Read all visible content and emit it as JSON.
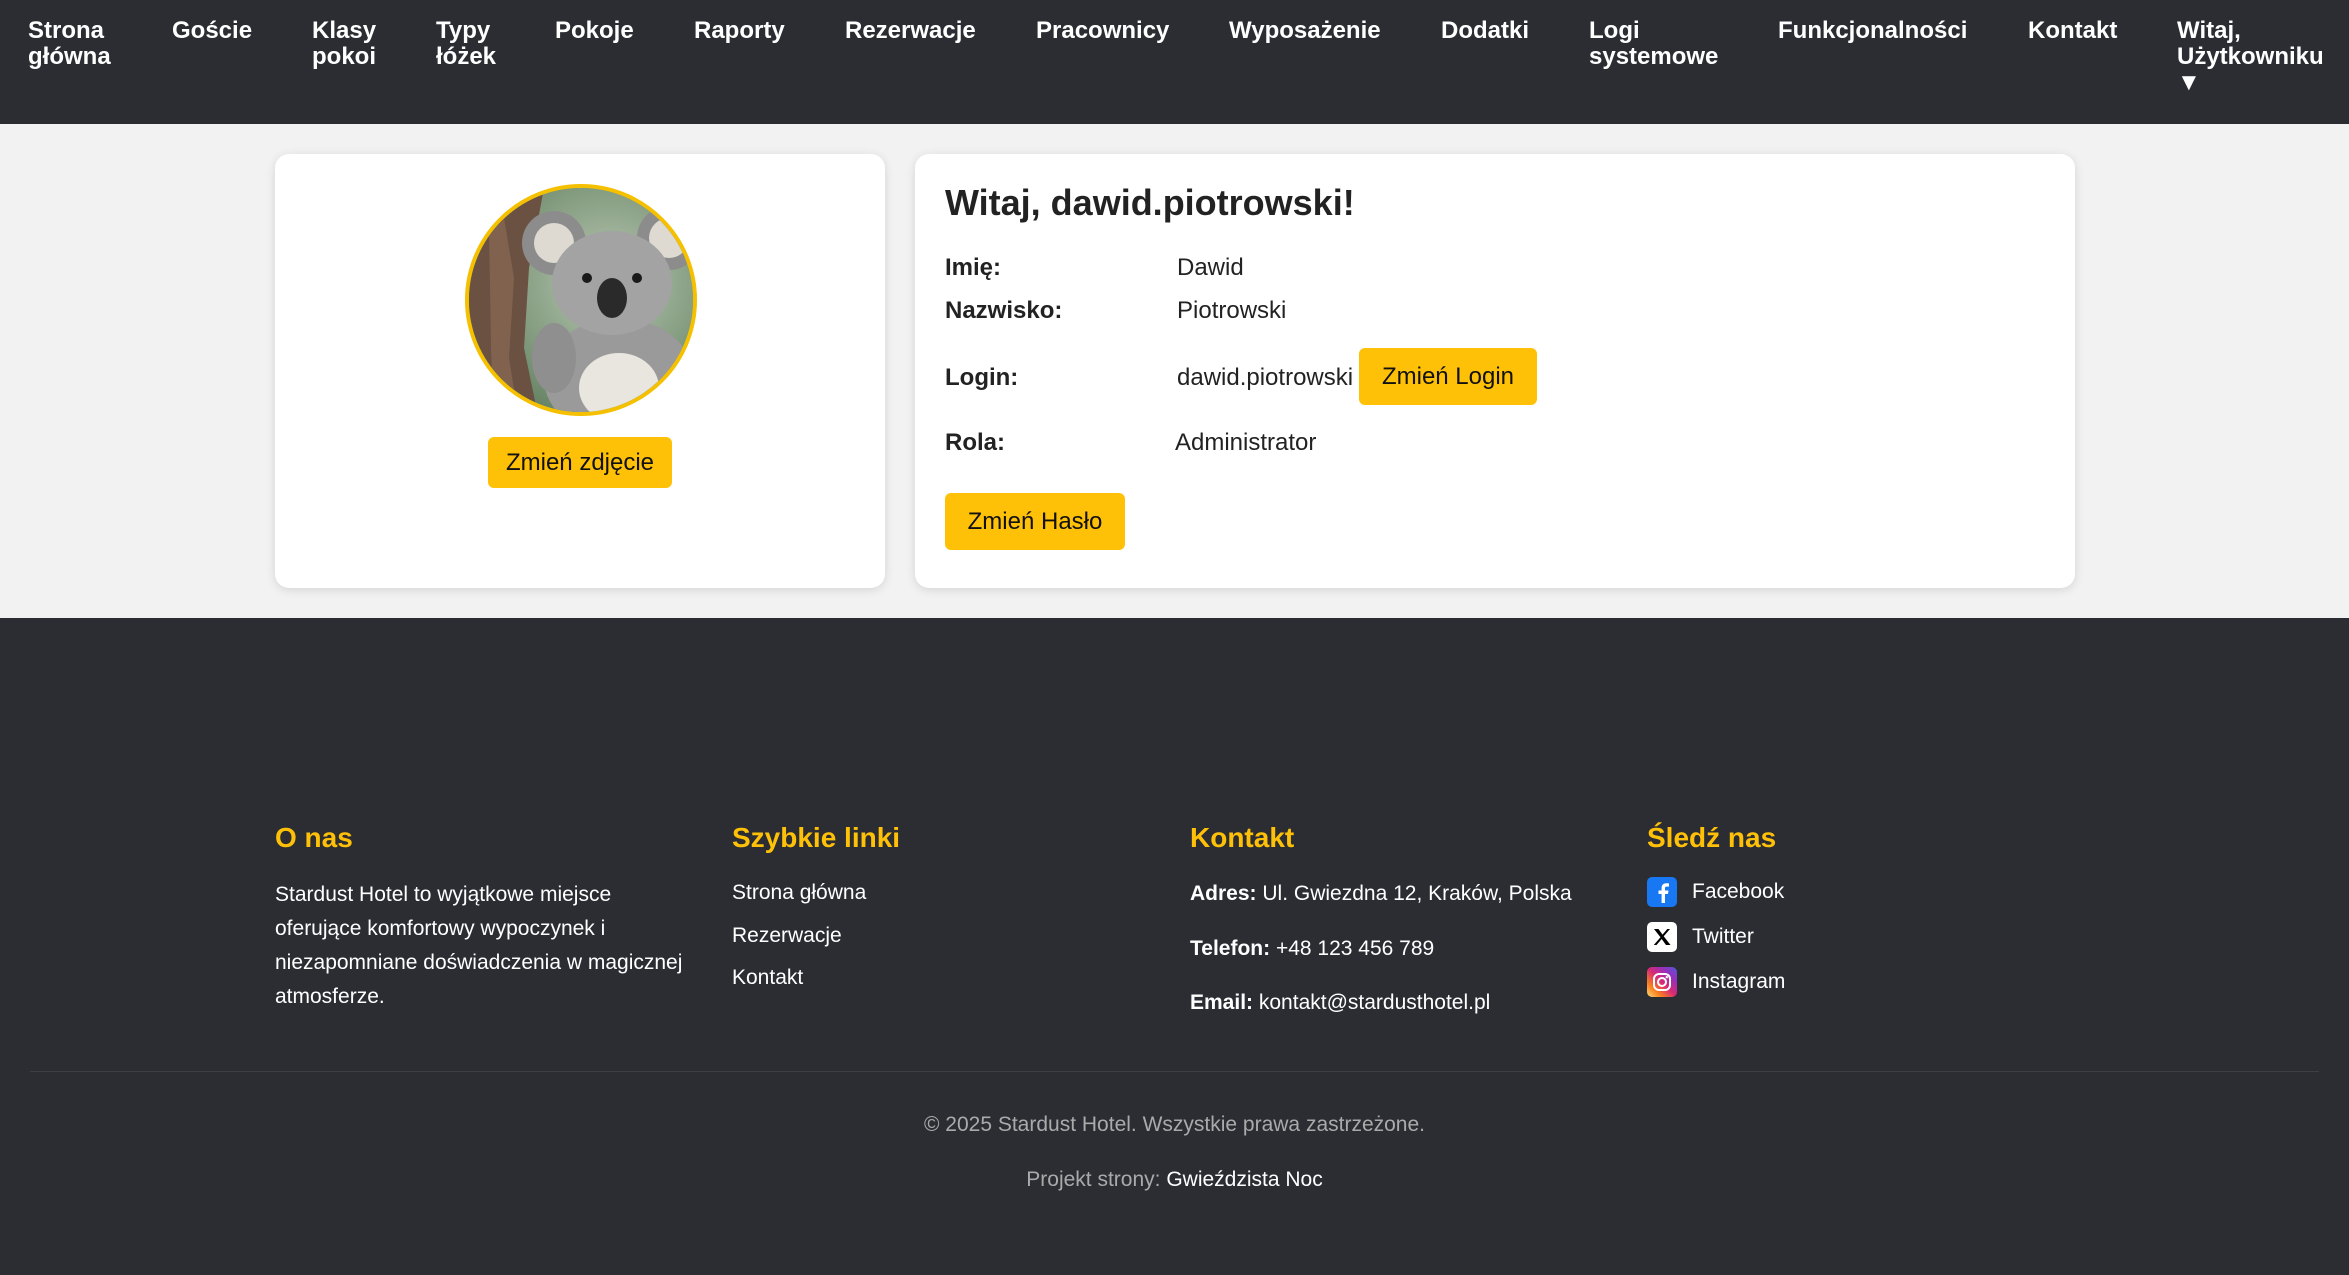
{
  "nav": {
    "items": [
      {
        "label": "Strona\ngłówna"
      },
      {
        "label": "Goście"
      },
      {
        "label": "Klasy\npokoi"
      },
      {
        "label": "Typy\nłóżek"
      },
      {
        "label": "Pokoje"
      },
      {
        "label": "Raporty"
      },
      {
        "label": "Rezerwacje"
      },
      {
        "label": "Pracownicy"
      },
      {
        "label": "Wyposażenie"
      },
      {
        "label": "Dodatki"
      },
      {
        "label": "Logi\nsystemowe"
      },
      {
        "label": "Funkcjonalności"
      },
      {
        "label": "Kontakt"
      },
      {
        "label": "Witaj,\nUżytkowniku\n▼"
      }
    ]
  },
  "profile": {
    "change_photo_label": "Zmień zdjęcie",
    "greeting": "Witaj, dawid.piotrowski!",
    "fields": {
      "first_name_label": "Imię:",
      "first_name": "Dawid",
      "last_name_label": "Nazwisko:",
      "last_name": "Piotrowski",
      "login_label": "Login:",
      "login": "dawid.piotrowski",
      "role_label": "Rola:",
      "role": "Administrator"
    },
    "change_login_label": "Zmień Login",
    "change_password_label": "Zmień Hasło"
  },
  "footer": {
    "about": {
      "title": "O nas",
      "text": "Stardust Hotel to wyjątkowe miejsce oferujące komfortowy wypoczynek i niezapomniane doświadczenia w magicznej atmosferze."
    },
    "quick_links": {
      "title": "Szybkie linki",
      "links": [
        "Strona główna",
        "Rezerwacje",
        "Kontakt"
      ]
    },
    "contact": {
      "title": "Kontakt",
      "address_label": "Adres:",
      "address": "Ul. Gwiezdna 12, Kraków, Polska",
      "phone_label": "Telefon:",
      "phone": "+48 123 456 789",
      "email_label": "Email:",
      "email": "kontakt@stardusthotel.pl"
    },
    "social": {
      "title": "Śledź nas",
      "items": [
        {
          "label": "Facebook",
          "icon": "facebook-icon",
          "color": "#1877f2"
        },
        {
          "label": "Twitter",
          "icon": "x-twitter-icon",
          "color": "#000000"
        },
        {
          "label": "Instagram",
          "icon": "instagram-icon",
          "color": "#d62976"
        }
      ]
    },
    "copyright": "© 2025 Stardust Hotel. Wszystkie prawa zastrzeżone.",
    "project_label": "Projekt strony:",
    "project_link": "Gwieździsta Noc"
  },
  "colors": {
    "dark": "#2b2d33",
    "accent": "#ffc107",
    "page_bg": "#f2f2f2"
  }
}
